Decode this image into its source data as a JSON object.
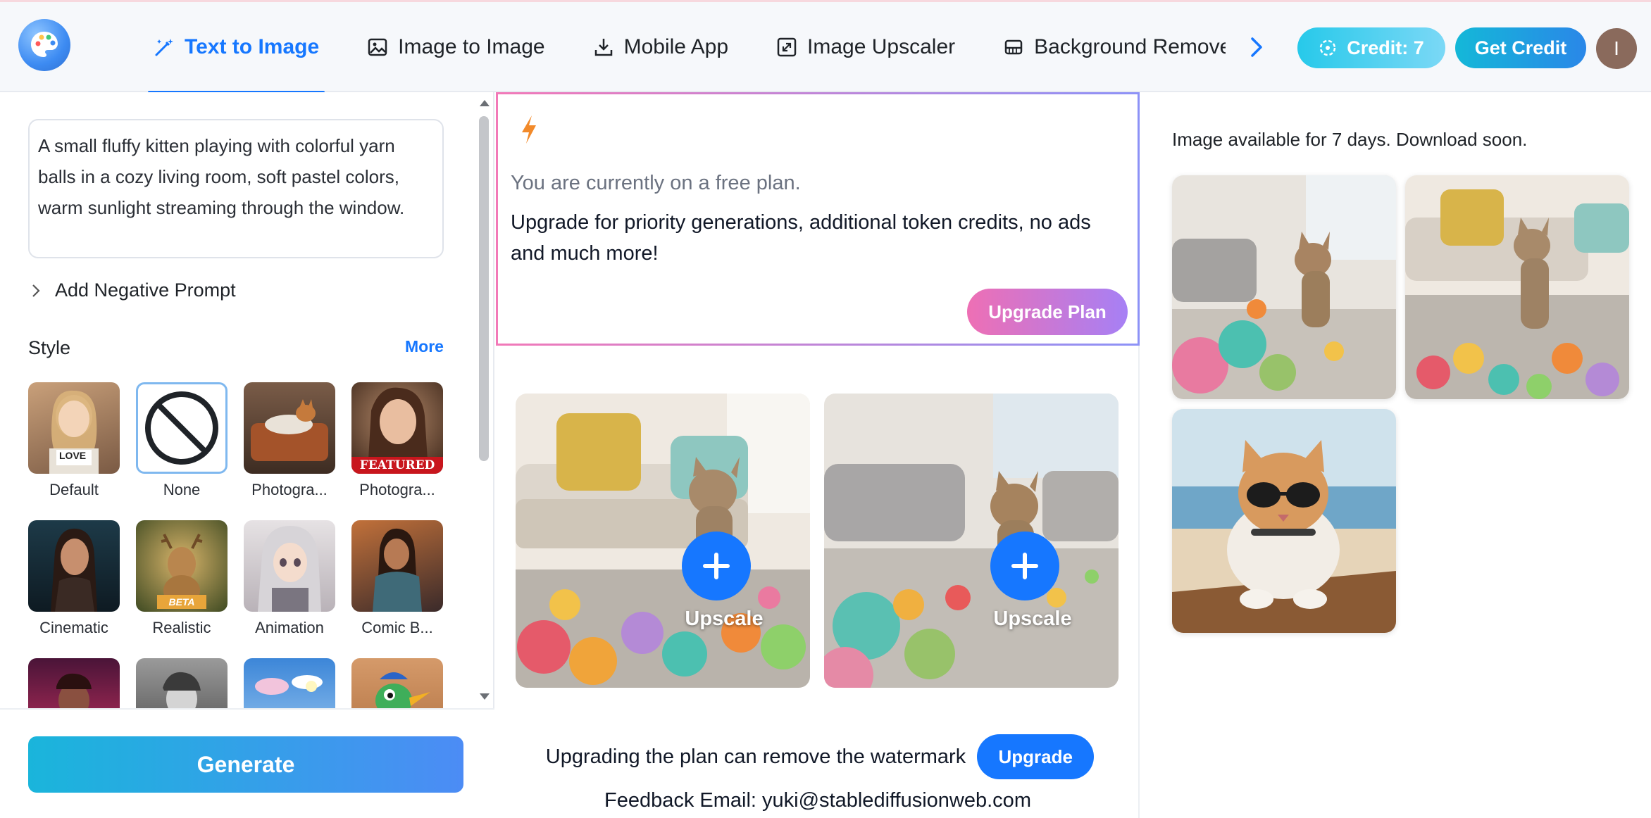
{
  "header": {
    "tabs": [
      {
        "label": "Text to Image",
        "icon": "magic-wand-icon",
        "active": true
      },
      {
        "label": "Image to Image",
        "icon": "image-icon",
        "active": false
      },
      {
        "label": "Mobile App",
        "icon": "download-icon",
        "active": false
      },
      {
        "label": "Image Upscaler",
        "icon": "expand-icon",
        "active": false
      },
      {
        "label": "Background Remover",
        "icon": "eraser-icon",
        "active": false
      }
    ],
    "credit_label": "Credit: 7",
    "get_credit_label": "Get Credit",
    "avatar_initial": "I"
  },
  "left": {
    "prompt_text": "A small fluffy kitten playing with colorful yarn balls in a cozy living room, soft pastel colors, warm sunlight streaming through the window.",
    "negative_prompt_label": "Add Negative Prompt",
    "style_label": "Style",
    "more_label": "More",
    "styles": [
      {
        "label": "Default",
        "badge": "LOVE"
      },
      {
        "label": "None",
        "badge": ""
      },
      {
        "label": "Photogra...",
        "badge": ""
      },
      {
        "label": "Photogra...",
        "badge": "FEATURED"
      },
      {
        "label": "Cinematic",
        "badge": ""
      },
      {
        "label": "Realistic",
        "badge": "BETA"
      },
      {
        "label": "Animation",
        "badge": ""
      },
      {
        "label": "Comic B...",
        "badge": ""
      },
      {
        "label": "",
        "badge": ""
      },
      {
        "label": "",
        "badge": ""
      },
      {
        "label": "",
        "badge": ""
      },
      {
        "label": "",
        "badge": ""
      }
    ],
    "selected_style": "None",
    "generate_label": "Generate"
  },
  "middle": {
    "promo_line1": "You are currently on a free plan.",
    "promo_line2": "Upgrade for priority generations, additional token credits, no ads and much more!",
    "upgrade_plan_label": "Upgrade Plan",
    "images": [
      {
        "action_label": "Upscale"
      },
      {
        "action_label": "Upscale"
      }
    ],
    "watermark_text": "Upgrading the plan can remove the watermark",
    "upgrade_label": "Upgrade",
    "feedback_text": "Feedback Email: yuki@stablediffusionweb.com"
  },
  "right": {
    "availability_text": "Image available for 7 days. Download soon."
  },
  "colors": {
    "accent": "#1677ff",
    "credit_gradient": [
      "#27c9ea",
      "#7bd8f6"
    ],
    "upgrade_plan_gradient": [
      "#ee6fb4",
      "#a680f5"
    ],
    "generate_gradient": [
      "#1ab5db",
      "#4c8cf5"
    ]
  }
}
